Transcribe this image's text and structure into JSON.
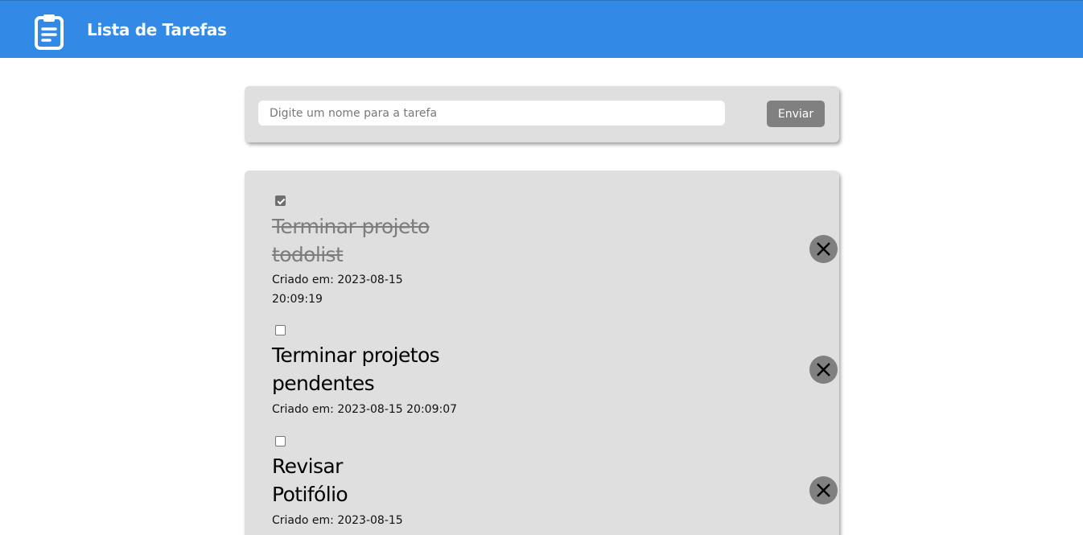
{
  "header": {
    "title": "Lista de Tarefas",
    "icon": "clipboard-icon",
    "color": "#3289e6"
  },
  "form": {
    "placeholder": "Digite um nome para a tarefa",
    "value": "",
    "submit_label": "Enviar"
  },
  "tasks": [
    {
      "title_lines": [
        "Terminar projeto",
        "todolist"
      ],
      "meta_lines": [
        "Criado em: 2023-08-15",
        "20:09:19"
      ],
      "checked": true
    },
    {
      "title_lines": [
        "Terminar projetos",
        "pendentes"
      ],
      "meta_lines": [
        "Criado em: 2023-08-15 20:09:07"
      ],
      "checked": false
    },
    {
      "title_lines": [
        "Revisar",
        "Potifólio"
      ],
      "meta_lines": [
        "Criado em: 2023-08-15"
      ],
      "checked": false
    }
  ],
  "colors": {
    "card_bg": "#dfdfdf",
    "button_bg": "#808080",
    "done_text": "#7d7d7d"
  }
}
